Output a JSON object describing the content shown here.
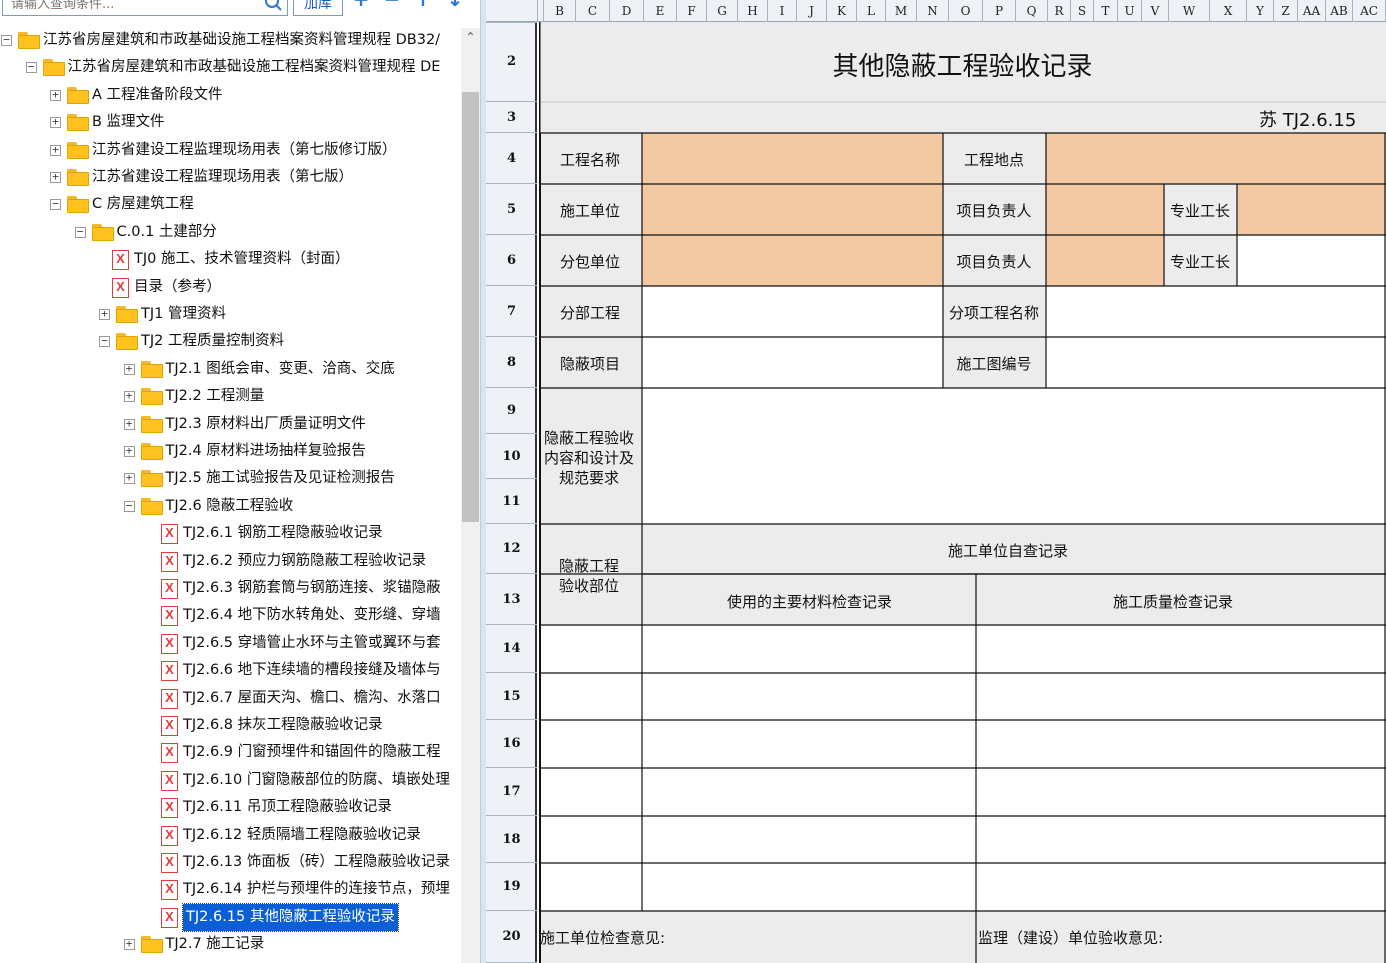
{
  "search": {
    "placeholder": "请输入查询条件...",
    "load_label": "加库"
  },
  "toolbar": {
    "add": "+",
    "remove": "−",
    "up": "↑",
    "down": "↓"
  },
  "tree": [
    {
      "label": "江苏省房屋建筑和市政基础设施工程档案资料管理规程 DB32/",
      "kind": "folder",
      "exp": "-",
      "level": 0
    },
    {
      "label": "江苏省房屋建筑和市政基础设施工程档案资料管理规程 DE",
      "kind": "folder",
      "exp": "-",
      "level": 1
    },
    {
      "label": "A 工程准备阶段文件",
      "kind": "folder",
      "exp": "+",
      "level": 2
    },
    {
      "label": "B 监理文件",
      "kind": "folder",
      "exp": "+",
      "level": 2
    },
    {
      "label": "江苏省建设工程监理现场用表（第七版修订版）",
      "kind": "folder",
      "exp": "+",
      "level": 2
    },
    {
      "label": "江苏省建设工程监理现场用表（第七版）",
      "kind": "folder",
      "exp": "+",
      "level": 2
    },
    {
      "label": "C 房屋建筑工程",
      "kind": "folder",
      "exp": "-",
      "level": 2
    },
    {
      "label": "C.0.1 土建部分",
      "kind": "folder",
      "exp": "-",
      "level": 3
    },
    {
      "label": "TJ0 施工、技术管理资料（封面）",
      "kind": "file",
      "level": 4
    },
    {
      "label": "目录（参考）",
      "kind": "file",
      "level": 4
    },
    {
      "label": "TJ1 管理资料",
      "kind": "folder",
      "exp": "+",
      "level": 4
    },
    {
      "label": "TJ2 工程质量控制资料",
      "kind": "folder",
      "exp": "-",
      "level": 4
    },
    {
      "label": "TJ2.1 图纸会审、变更、洽商、交底",
      "kind": "folder",
      "exp": "+",
      "level": 5
    },
    {
      "label": "TJ2.2 工程测量",
      "kind": "folder",
      "exp": "+",
      "level": 5
    },
    {
      "label": "TJ2.3 原材料出厂质量证明文件",
      "kind": "folder",
      "exp": "+",
      "level": 5
    },
    {
      "label": "TJ2.4 原材料进场抽样复验报告",
      "kind": "folder",
      "exp": "+",
      "level": 5
    },
    {
      "label": "TJ2.5 施工试验报告及见证检测报告",
      "kind": "folder",
      "exp": "+",
      "level": 5
    },
    {
      "label": "TJ2.6 隐蔽工程验收",
      "kind": "folder",
      "exp": "-",
      "level": 5
    },
    {
      "label": "TJ2.6.1 钢筋工程隐蔽验收记录",
      "kind": "file",
      "level": 6
    },
    {
      "label": "TJ2.6.2 预应力钢筋隐蔽工程验收记录",
      "kind": "file",
      "level": 6
    },
    {
      "label": "TJ2.6.3 钢筋套筒与钢筋连接、浆锚隐蔽",
      "kind": "file",
      "level": 6
    },
    {
      "label": "TJ2.6.4 地下防水转角处、变形缝、穿墙",
      "kind": "file",
      "level": 6
    },
    {
      "label": "TJ2.6.5 穿墙管止水环与主管或翼环与套",
      "kind": "file",
      "level": 6
    },
    {
      "label": "TJ2.6.6 地下连续墙的槽段接缝及墙体与",
      "kind": "file",
      "level": 6
    },
    {
      "label": "TJ2.6.7 屋面天沟、檐口、檐沟、水落口",
      "kind": "file",
      "level": 6
    },
    {
      "label": "TJ2.6.8 抹灰工程隐蔽验收记录",
      "kind": "file",
      "level": 6
    },
    {
      "label": "TJ2.6.9 门窗预埋件和锚固件的隐蔽工程",
      "kind": "file",
      "level": 6
    },
    {
      "label": "TJ2.6.10 门窗隐蔽部位的防腐、填嵌处理",
      "kind": "file",
      "level": 6
    },
    {
      "label": "TJ2.6.11 吊顶工程隐蔽验收记录",
      "kind": "file",
      "level": 6
    },
    {
      "label": "TJ2.6.12 轻质隔墙工程隐蔽验收记录",
      "kind": "file",
      "level": 6
    },
    {
      "label": "TJ2.6.13 饰面板（砖）工程隐蔽验收记录",
      "kind": "file",
      "level": 6
    },
    {
      "label": "TJ2.6.14 护栏与预埋件的连接节点，预埋",
      "kind": "file",
      "level": 6
    },
    {
      "label": "TJ2.6.15 其他隐蔽工程验收记录",
      "kind": "file",
      "level": 6,
      "selected": true
    },
    {
      "label": "TJ2.7 施工记录",
      "kind": "folder",
      "exp": "+",
      "level": 5
    }
  ],
  "columns": [
    "B",
    "C",
    "D",
    "E",
    "F",
    "G",
    "H",
    "I",
    "J",
    "K",
    "L",
    "M",
    "N",
    "O",
    "P",
    "Q",
    "R",
    "S",
    "T",
    "U",
    "V",
    "W",
    "X",
    "Y",
    "Z",
    "AA",
    "AB",
    "AC"
  ],
  "rows": [
    "2",
    "3",
    "4",
    "5",
    "6",
    "7",
    "8",
    "9",
    "10",
    "11",
    "12",
    "13",
    "14",
    "15",
    "16",
    "17",
    "18",
    "19",
    "20"
  ],
  "form": {
    "title": "其他隐蔽工程验收记录",
    "code": "苏 TJ2.6.15",
    "labels": {
      "project_name": "工程名称",
      "project_location": "工程地点",
      "construction_unit": "施工单位",
      "project_manager_1": "项目负责人",
      "foreman_1": "专业工长",
      "subcontractor": "分包单位",
      "project_manager_2": "项目负责人",
      "foreman_2": "专业工长",
      "division": "分部工程",
      "sub_item_name": "分项工程名称",
      "concealed_item": "隐蔽项目",
      "drawing_no": "施工图编号",
      "content_line1": "隐蔽工程验收",
      "content_line2": "内容和设计及",
      "content_line3": "规范要求",
      "part_line1": "隐蔽工程",
      "part_line2": "验收部位",
      "self_check": "施工单位自查记录",
      "material_check": "使用的主要材料检查记录",
      "quality_check": "施工质量检查记录",
      "unit_opinion": "施工单位检查意见:",
      "supervisor_opinion": "监理（建设）单位验收意见:"
    }
  },
  "colors": {
    "input_fill": "#f3c9a3",
    "label_fill": "#ececec",
    "selection": "#0b5fd6",
    "folder": "#ffc21f"
  }
}
